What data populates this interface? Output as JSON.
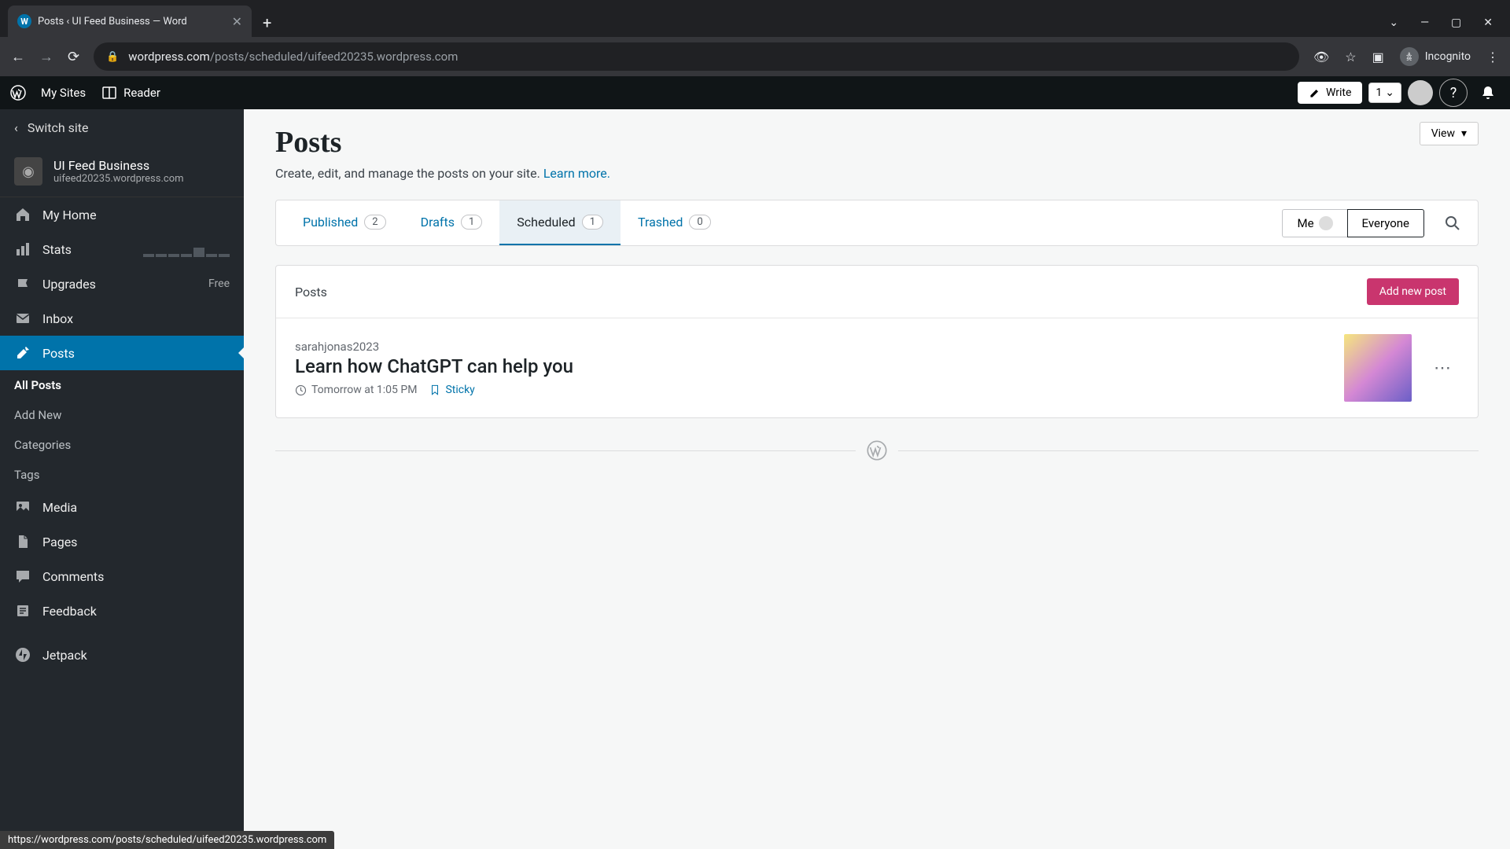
{
  "browser": {
    "tab_title": "Posts ‹ UI Feed Business — Word",
    "url_host": "wordpress.com",
    "url_path": "/posts/scheduled/uifeed20235.wordpress.com",
    "incognito": "Incognito"
  },
  "adminbar": {
    "my_sites": "My Sites",
    "reader": "Reader",
    "write": "Write",
    "notif_count": "1"
  },
  "sidebar": {
    "switch_site": "Switch site",
    "site_name": "UI Feed Business",
    "site_url": "uifeed20235.wordpress.com",
    "items": {
      "home": "My Home",
      "stats": "Stats",
      "upgrades": "Upgrades",
      "upgrades_badge": "Free",
      "inbox": "Inbox",
      "posts": "Posts",
      "media": "Media",
      "pages": "Pages",
      "comments": "Comments",
      "feedback": "Feedback",
      "jetpack": "Jetpack"
    },
    "posts_sub": {
      "all": "All Posts",
      "add": "Add New",
      "categories": "Categories",
      "tags": "Tags"
    }
  },
  "content": {
    "view": "View",
    "title": "Posts",
    "desc": "Create, edit, and manage the posts on your site. ",
    "learn_more": "Learn more.",
    "tabs": {
      "published": {
        "label": "Published",
        "count": "2"
      },
      "drafts": {
        "label": "Drafts",
        "count": "1"
      },
      "scheduled": {
        "label": "Scheduled",
        "count": "1"
      },
      "trashed": {
        "label": "Trashed",
        "count": "0"
      }
    },
    "filter": {
      "me": "Me",
      "everyone": "Everyone"
    },
    "panel_title": "Posts",
    "add_post": "Add new post",
    "post": {
      "author": "sarahjonas2023",
      "title": "Learn how ChatGPT can help you",
      "date": "Tomorrow at 1:05 PM",
      "sticky": "Sticky"
    }
  },
  "status_url": "https://wordpress.com/posts/scheduled/uifeed20235.wordpress.com"
}
